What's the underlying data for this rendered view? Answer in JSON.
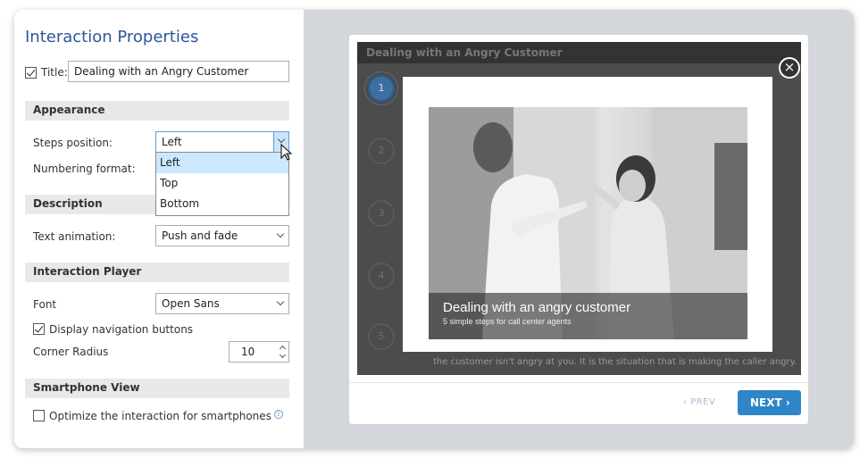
{
  "panel": {
    "title": "Interaction Properties",
    "title_label": "Title:",
    "title_value": "Dealing with an Angry Customer",
    "appearance": {
      "header": "Appearance",
      "steps_position_label": "Steps position:",
      "steps_position_value": "Left",
      "numbering_format_label": "Numbering format:",
      "dropdown_options": [
        "Left",
        "Top",
        "Bottom"
      ]
    },
    "description": {
      "header": "Description",
      "text_animation_label": "Text animation:",
      "text_animation_value": "Push and fade"
    },
    "player": {
      "header": "Interaction Player",
      "font_label": "Font",
      "font_value": "Open Sans",
      "display_nav_label": "Display navigation buttons",
      "corner_radius_label": "Corner Radius",
      "corner_radius_value": "10"
    },
    "smartphone": {
      "header": "Smartphone View",
      "optimize_label": "Optimize the interaction for smartphones",
      "info_glyph": "i"
    }
  },
  "preview": {
    "header_title": "Dealing with an Angry Customer",
    "steps": [
      "1",
      "2",
      "3",
      "4",
      "5"
    ],
    "close_glyph": "×",
    "caption_title": "Dealing with an angry customer",
    "caption_subtitle": "5 simple steps for call center agents",
    "body_text_line1": "t",
    "body_text_line2": "the customer isn't angry at you. It is the situation that is making the caller angry.",
    "prev_label": "PREV",
    "next_label": "NEXT"
  },
  "colors": {
    "accent": "#2e86c8",
    "title": "#2b579a",
    "dropdown_selected": "#cce8ff"
  }
}
